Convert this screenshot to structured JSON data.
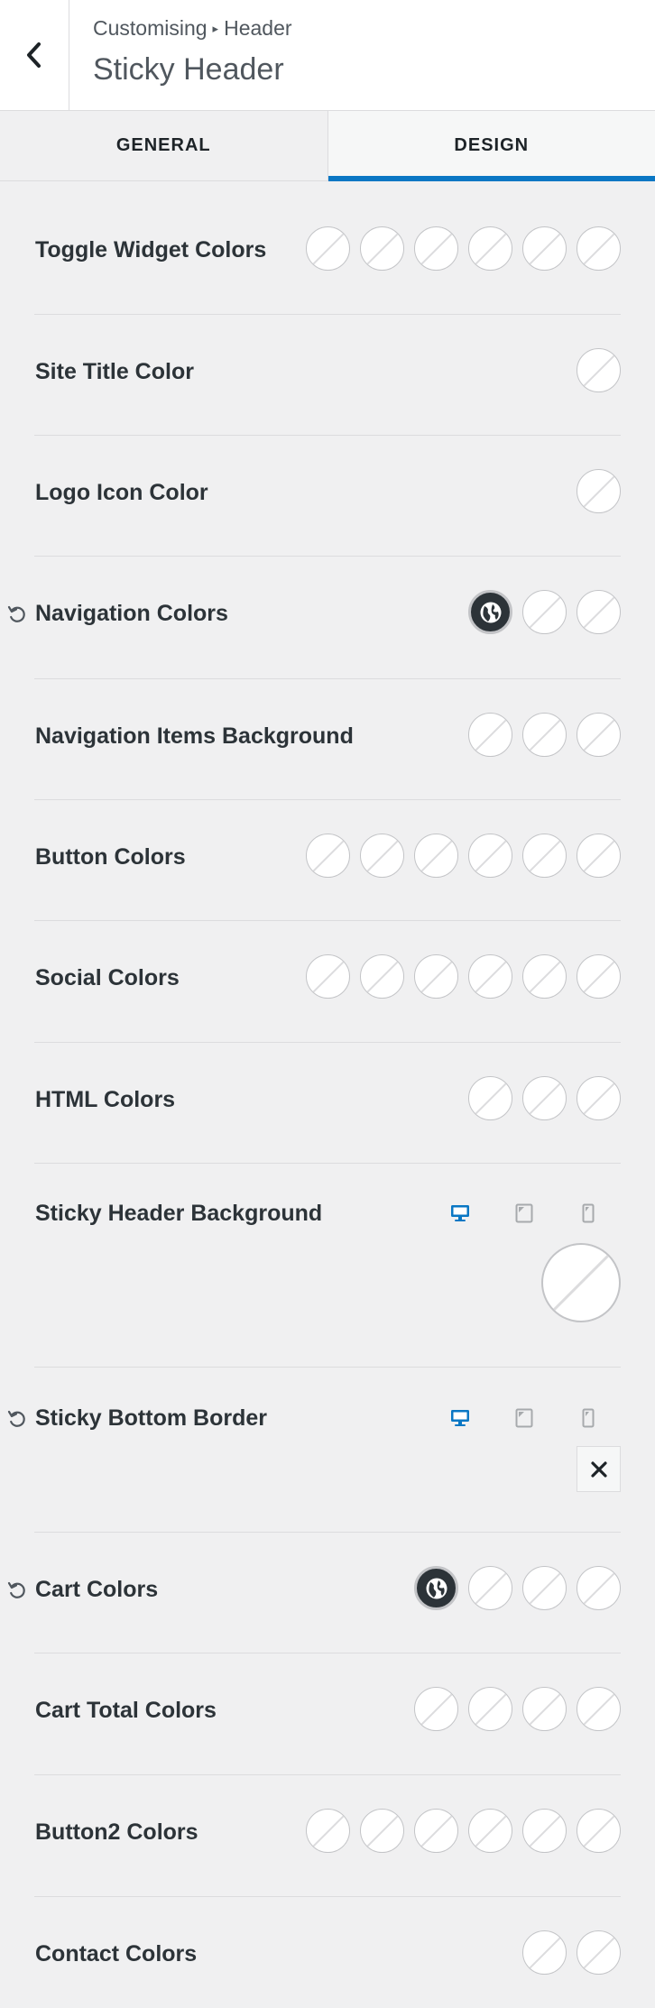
{
  "header": {
    "breadcrumb_root": "Customising",
    "breadcrumb_sep": "▸",
    "breadcrumb_section": "Header",
    "title": "Sticky Header"
  },
  "tabs": [
    {
      "label": "GENERAL",
      "active": false
    },
    {
      "label": "DESIGN",
      "active": true
    }
  ],
  "rows": [
    {
      "label": "Toggle Widget Colors",
      "swatches": 6,
      "reset": false
    },
    {
      "label": "Site Title Color",
      "swatches": 1,
      "reset": false
    },
    {
      "label": "Logo Icon Color",
      "swatches": 1,
      "reset": false
    },
    {
      "label": "Navigation Colors",
      "swatches": 3,
      "reset": true,
      "first_global": true
    },
    {
      "label": "Navigation Items Background",
      "swatches": 3,
      "reset": false
    },
    {
      "label": "Button Colors",
      "swatches": 6,
      "reset": false
    },
    {
      "label": "Social Colors",
      "swatches": 6,
      "reset": false
    },
    {
      "label": "HTML Colors",
      "swatches": 3,
      "reset": false
    },
    {
      "label": "Sticky Header Background",
      "responsive": true,
      "big_swatch": true,
      "reset": false
    },
    {
      "label": "Sticky Bottom Border",
      "responsive": true,
      "x_button": true,
      "reset": true
    },
    {
      "label": "Cart Colors",
      "swatches": 4,
      "reset": true,
      "first_global": true
    },
    {
      "label": "Cart Total Colors",
      "swatches": 4,
      "reset": false
    },
    {
      "label": "Button2 Colors",
      "swatches": 6,
      "reset": false
    },
    {
      "label": "Contact Colors",
      "swatches": 2,
      "reset": false
    }
  ],
  "colors": {
    "accent": "#0a77c4",
    "device_inactive": "#a7aaad",
    "global_swatch": "#2c3338",
    "background": "#f0f0f1"
  },
  "icons": {
    "back": "chevron-left-icon",
    "reset": "undo-icon",
    "global": "globe-icon",
    "desktop": "desktop-icon",
    "tablet": "tablet-icon",
    "mobile": "mobile-icon",
    "clear": "close-icon"
  }
}
